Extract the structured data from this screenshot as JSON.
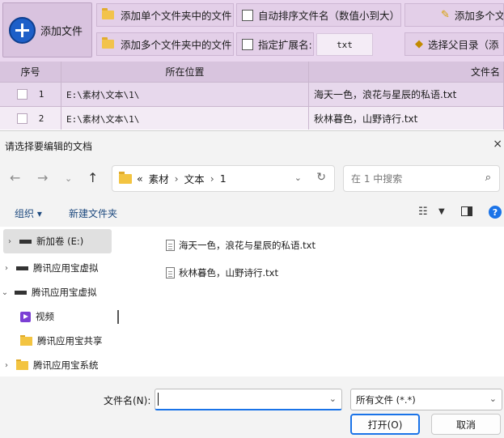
{
  "app": {
    "add_file": "添加文件",
    "add_single_folder": "添加单个文件夹中的文件",
    "add_multi_folder": "添加多个文件夹中的文件",
    "auto_sort": "自动排序文件名（数值小到大）",
    "specify_ext": "指定扩展名:",
    "ext_value": "txt",
    "add_multi_right": "添加多个文",
    "select_parent": "选择父目录（添",
    "columns": {
      "index": "序号",
      "location": "所在位置",
      "filename": "文件名"
    },
    "rows": [
      {
        "index": "1",
        "location": "E:\\素材\\文本\\1\\",
        "filename": "海天一色，浪花与星辰的私语.txt"
      },
      {
        "index": "2",
        "location": "E:\\素材\\文本\\1\\",
        "filename": "秋林暮色，山野诗行.txt"
      }
    ]
  },
  "dialog": {
    "title": "请选择要编辑的文档",
    "close": "×",
    "address": {
      "prefix": "«",
      "crumbs": [
        "素材",
        "文本",
        "1"
      ],
      "sep": "›"
    },
    "search_placeholder": "在 1 中搜索",
    "organize": "组织 ▾",
    "new_folder": "新建文件夹",
    "tree": [
      {
        "label": "新加卷 (E:)",
        "type": "drive",
        "chevron": "›",
        "selected": true
      },
      {
        "label": "腾讯应用宝虚拟",
        "type": "drive",
        "chevron": "›"
      },
      {
        "label": "腾讯应用宝虚拟",
        "type": "drive",
        "chevron": "⌄"
      },
      {
        "label": "视频",
        "type": "video",
        "chevron": ""
      },
      {
        "label": "腾讯应用宝共享",
        "type": "folder",
        "chevron": ""
      },
      {
        "label": "腾讯应用宝系统",
        "type": "folder",
        "chevron": "›"
      }
    ],
    "files": [
      "海天一色，浪花与星辰的私语.txt",
      "秋林暮色，山野诗行.txt"
    ],
    "filename_label": "文件名(N):",
    "filename_value": "",
    "filetype": "所有文件 (*.*)",
    "open_button": "打开(O)",
    "cancel_button": "取消"
  }
}
